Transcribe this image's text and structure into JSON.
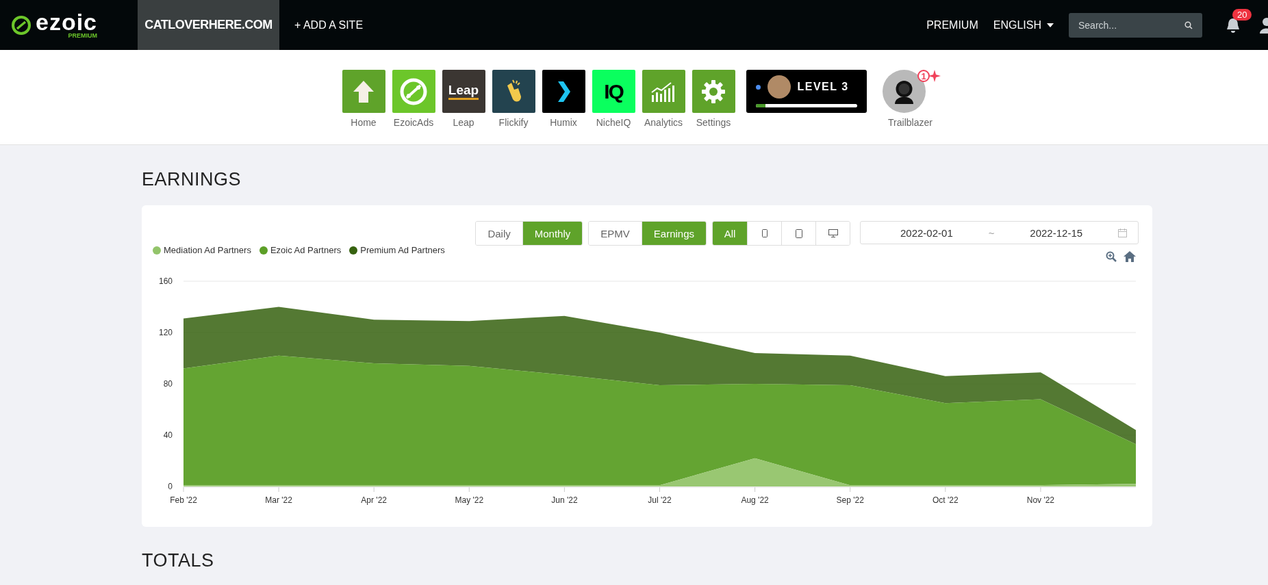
{
  "topbar": {
    "logo": "ezoic",
    "logo_sub": "PREMIUM",
    "site": "CATLOVERHERE.COM",
    "add_site": "+ ADD A SITE",
    "premium": "PREMIUM",
    "language": "ENGLISH",
    "search": {
      "placeholder": "Search..."
    },
    "notifications": "20"
  },
  "apps": [
    {
      "kind": "home",
      "label": "Home",
      "color": "#5fa32a"
    },
    {
      "kind": "ezoicads",
      "label": "EzoicAds",
      "color": "#6cc62a"
    },
    {
      "kind": "leap",
      "label": "Leap",
      "color": "#3b3632",
      "logo_text": "Leap"
    },
    {
      "kind": "flickify",
      "label": "Flickify",
      "color": "#23434f"
    },
    {
      "kind": "humix",
      "label": "Humix",
      "color": "#000000"
    },
    {
      "kind": "nicheiq",
      "label": "NicheIQ",
      "color": "#0aff5e",
      "logo_text": "IQ"
    },
    {
      "kind": "analytics",
      "label": "Analytics",
      "color": "#5fa32a"
    },
    {
      "kind": "settings",
      "label": "Settings",
      "color": "#5fa32a"
    }
  ],
  "level_badge": {
    "title": "LEVEL 3",
    "level": 0.1
  },
  "trailblazer": {
    "label": "Trailblazer",
    "count": "1"
  },
  "earnings": {
    "title": "EARNINGS",
    "period": [
      {
        "label": "Daily",
        "selected": false
      },
      {
        "label": "Monthly",
        "selected": true
      }
    ],
    "metric": [
      {
        "label": "EPMV",
        "selected": false
      },
      {
        "label": "Earnings",
        "selected": true
      }
    ],
    "device": [
      {
        "kind": "all",
        "label": "All",
        "selected": true
      },
      {
        "kind": "phone",
        "selected": false
      },
      {
        "kind": "tablet",
        "selected": false
      },
      {
        "kind": "desktop",
        "selected": false
      }
    ],
    "date_from": "2022-02-01",
    "date_sep": "~",
    "date_to": "2022-12-15",
    "chart_data": {
      "type": "area",
      "stacked": true,
      "categories": [
        "Feb '22",
        "Mar '22",
        "Apr '22",
        "May '22",
        "Jun '22",
        "Jul '22",
        "Aug '22",
        "Sep '22",
        "Oct '22",
        "Nov '22",
        null
      ],
      "ylim": [
        0,
        160
      ],
      "yticks": [
        0,
        40,
        80,
        120,
        160
      ],
      "series": [
        {
          "name": "Mediation Ad Partners",
          "color": "#93c46a",
          "values": [
            1,
            1,
            1,
            1,
            1,
            1,
            22,
            1,
            1,
            1,
            2
          ]
        },
        {
          "name": "Ezoic Ad Partners",
          "color": "#5c9f27",
          "values": [
            91,
            101,
            95,
            93,
            86,
            78,
            58,
            78,
            64,
            67,
            31
          ]
        },
        {
          "name": "Premium Ad Partners",
          "color": "#36620f",
          "values": [
            39,
            38,
            34,
            35,
            46,
            41,
            24,
            23,
            21,
            21,
            11
          ]
        }
      ]
    }
  },
  "totals": {
    "title": "TOTALS"
  }
}
